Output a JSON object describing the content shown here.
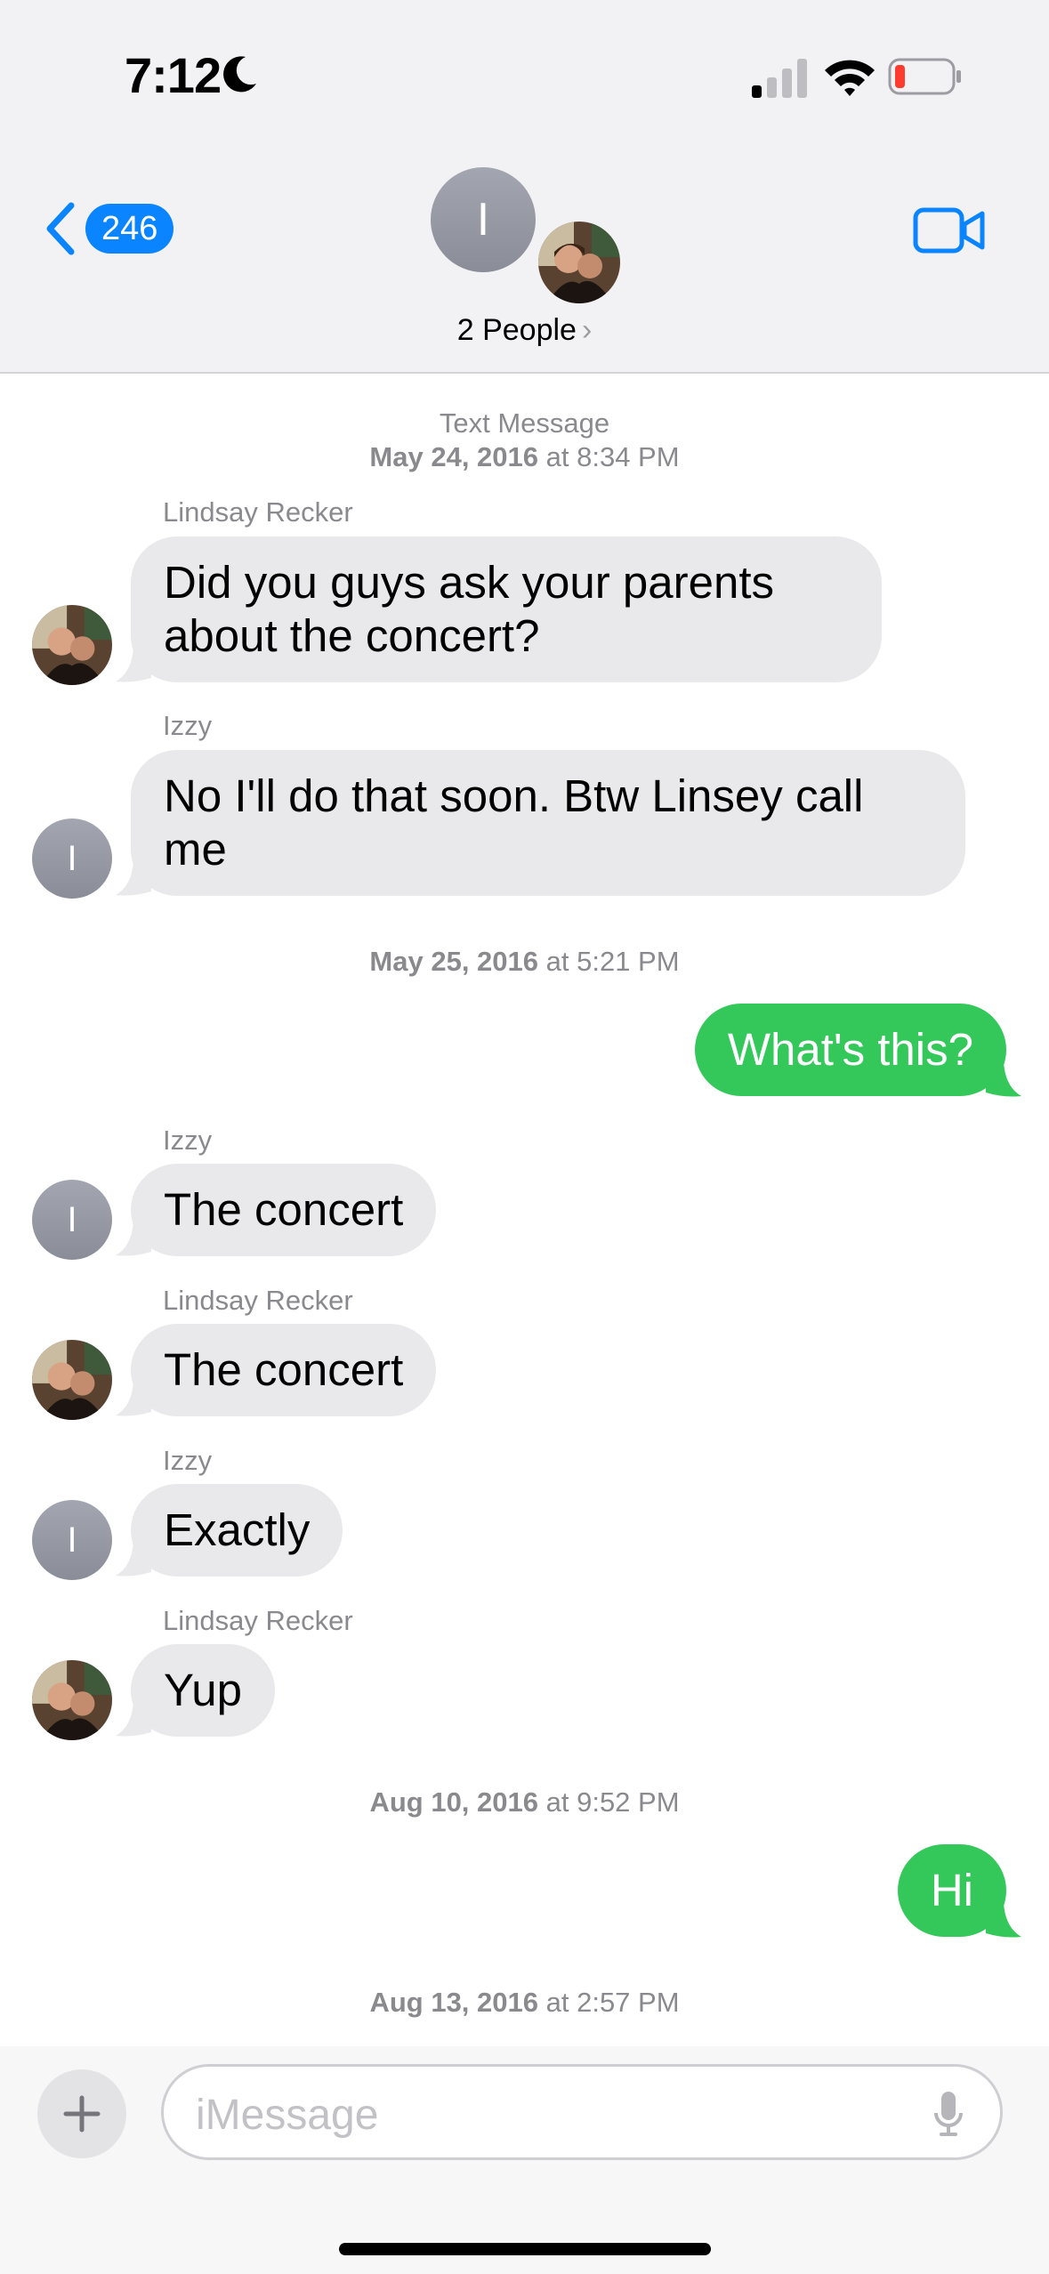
{
  "status_bar": {
    "time": "7:12",
    "battery_low": true
  },
  "header": {
    "back_count": "246",
    "group_initial": "I",
    "people_label": "2 People",
    "people_chevron": "›"
  },
  "stamps": {
    "s1_type": "Text Message",
    "s1_date": "May 24, 2016",
    "s1_time": "at 8:34 PM",
    "s2_date": "May 25, 2016",
    "s2_time": "at 5:21 PM",
    "s3_date": "Aug 10, 2016",
    "s3_time": "at 9:52 PM",
    "s4_date": "Aug 13, 2016",
    "s4_time": "at 2:57 PM"
  },
  "messages": [
    {
      "sender": "Lindsay Recker",
      "text": "Did you guys ask your parents about the concert?"
    },
    {
      "sender": "Izzy",
      "initial": "I",
      "text": "No I'll do that soon. Btw Linsey call me"
    },
    {
      "text": "What's this?"
    },
    {
      "sender": "Izzy",
      "initial": "I",
      "text": "The concert"
    },
    {
      "sender": "Lindsay Recker",
      "text": "The concert"
    },
    {
      "sender": "Izzy",
      "initial": "I",
      "text": "Exactly"
    },
    {
      "sender": "Lindsay Recker",
      "text": "Yup"
    },
    {
      "text": "Hi"
    }
  ],
  "compose": {
    "placeholder": "iMessage"
  },
  "colors": {
    "accent": "#0a84ff",
    "sent_bubble": "#34c759",
    "received_bubble": "#e9e9eb"
  },
  "icons": [
    "moon-icon",
    "signal-icon",
    "wifi-icon",
    "battery-icon",
    "back-chevron-icon",
    "video-camera-icon",
    "plus-icon",
    "microphone-icon"
  ]
}
